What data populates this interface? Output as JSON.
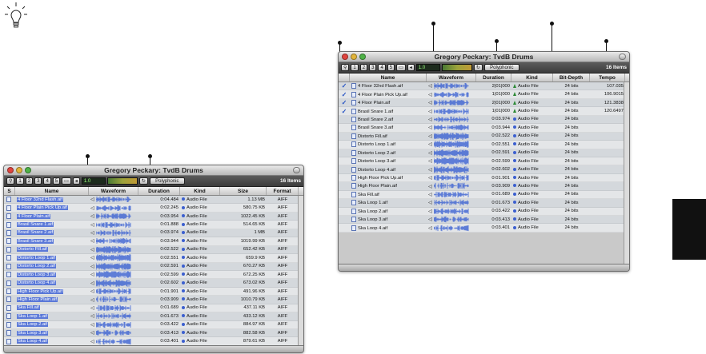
{
  "left_window": {
    "title": "Gregory Peckary: TvdB Drums",
    "toolbar": {
      "buttons": [
        "1",
        "2",
        "3",
        "4",
        "5"
      ],
      "meter": "1.0",
      "mode": "Polyphonic",
      "items": "16 Items"
    },
    "columns": [
      "S",
      "Name",
      "Waveform",
      "Duration",
      "Kind",
      "Size",
      "Format"
    ],
    "rows": [
      {
        "name": "4 Floor 32nd Flash.aif",
        "duration": "0:04.484",
        "kind": "Audio File",
        "size": "1.13 MB",
        "format": "AIFF"
      },
      {
        "name": "4 Floor Plain Pick Up.aif",
        "duration": "0:02.245",
        "kind": "Audio File",
        "size": "580.75 KB",
        "format": "AIFF"
      },
      {
        "name": "4 Floor Plain.aif",
        "duration": "0:03.954",
        "kind": "Audio File",
        "size": "1022.45 KB",
        "format": "AIFF"
      },
      {
        "name": "Brasil Snare 1.aif",
        "duration": "0:01.888",
        "kind": "Audio File",
        "size": "514.65 KB",
        "format": "AIFF"
      },
      {
        "name": "Brasil Snare 2.aif",
        "duration": "0:03.974",
        "kind": "Audio File",
        "size": "1 MB",
        "format": "AIFF"
      },
      {
        "name": "Brasil Snare 3.aif",
        "duration": "0:03.944",
        "kind": "Audio File",
        "size": "1019.99 KB",
        "format": "AIFF"
      },
      {
        "name": "Distorto Fill.aif",
        "duration": "0:02.522",
        "kind": "Audio File",
        "size": "652.42 KB",
        "format": "AIFF"
      },
      {
        "name": "Distorto Loop 1.aif",
        "duration": "0:02.551",
        "kind": "Audio File",
        "size": "659.9 KB",
        "format": "AIFF"
      },
      {
        "name": "Distorto Loop 2.aif",
        "duration": "0:02.591",
        "kind": "Audio File",
        "size": "670.27 KB",
        "format": "AIFF"
      },
      {
        "name": "Distorto Loop 3.aif",
        "duration": "0:02.599",
        "kind": "Audio File",
        "size": "672.25 KB",
        "format": "AIFF"
      },
      {
        "name": "Distorto Loop 4.aif",
        "duration": "0:02.602",
        "kind": "Audio File",
        "size": "673.02 KB",
        "format": "AIFF"
      },
      {
        "name": "High Floor Pick Up.aif",
        "duration": "0:01.901",
        "kind": "Audio File",
        "size": "491.96 KB",
        "format": "AIFF"
      },
      {
        "name": "High Floor Plain.aif",
        "duration": "0:03.909",
        "kind": "Audio File",
        "size": "1010.79 KB",
        "format": "AIFF"
      },
      {
        "name": "Ska Fill.aif",
        "duration": "0:01.689",
        "kind": "Audio File",
        "size": "437.11 KB",
        "format": "AIFF"
      },
      {
        "name": "Ska Loop 1.aif",
        "duration": "0:01.673",
        "kind": "Audio File",
        "size": "433.12 KB",
        "format": "AIFF"
      },
      {
        "name": "Ska Loop 2.aif",
        "duration": "0:03.422",
        "kind": "Audio File",
        "size": "884.97 KB",
        "format": "AIFF"
      },
      {
        "name": "Ska Loop 3.aif",
        "duration": "0:03.413",
        "kind": "Audio File",
        "size": "882.58 KB",
        "format": "AIFF"
      },
      {
        "name": "Ska Loop 4.aif",
        "duration": "0:03.401",
        "kind": "Audio File",
        "size": "879.61 KB",
        "format": "AIFF"
      }
    ]
  },
  "right_window": {
    "title": "Gregory Peckary: TvdB Drums",
    "toolbar": {
      "buttons": [
        "1",
        "2",
        "3",
        "4",
        "5"
      ],
      "meter": "1.0",
      "mode": "Polyphonic",
      "items": "16 Items"
    },
    "columns": [
      "",
      "Name",
      "Waveform",
      "Duration",
      "Kind",
      "Bit-Depth",
      "Tempo"
    ],
    "rows": [
      {
        "check": "✓",
        "name": "4 Floor 32nd Flash.aif",
        "duration": "2|01|000",
        "kind": "Audio File",
        "kind_icon": "triangle",
        "bits": "24 bits",
        "tempo": "107.035"
      },
      {
        "check": "✓",
        "name": "4 Floor Plain Pick Up.aif",
        "duration": "1|01|000",
        "kind": "Audio File",
        "kind_icon": "triangle",
        "bits": "24 bits",
        "tempo": "106.9015"
      },
      {
        "check": "✓",
        "name": "4 Floor Plain.aif",
        "duration": "2|01|000",
        "kind": "Audio File",
        "kind_icon": "triangle",
        "bits": "24 bits",
        "tempo": "121.3838"
      },
      {
        "check": "✓",
        "name": "Brasil Snare 1.aif",
        "duration": "1|01|000",
        "kind": "Audio File",
        "kind_icon": "triangle",
        "bits": "24 bits",
        "tempo": "120.6497"
      },
      {
        "check": "",
        "name": "Brasil Snare 2.aif",
        "duration": "0:03.974",
        "kind": "Audio File",
        "kind_icon": "dot",
        "bits": "24 bits",
        "tempo": ""
      },
      {
        "check": "",
        "name": "Brasil Snare 3.aif",
        "duration": "0:03.944",
        "kind": "Audio File",
        "kind_icon": "dot",
        "bits": "24 bits",
        "tempo": ""
      },
      {
        "check": "",
        "name": "Distorto Fill.aif",
        "duration": "0:02.522",
        "kind": "Audio File",
        "kind_icon": "dot",
        "bits": "24 bits",
        "tempo": ""
      },
      {
        "check": "",
        "name": "Distorto Loop 1.aif",
        "duration": "0:02.551",
        "kind": "Audio File",
        "kind_icon": "dot",
        "bits": "24 bits",
        "tempo": ""
      },
      {
        "check": "",
        "name": "Distorto Loop 2.aif",
        "duration": "0:02.591",
        "kind": "Audio File",
        "kind_icon": "dot",
        "bits": "24 bits",
        "tempo": ""
      },
      {
        "check": "",
        "name": "Distorto Loop 3.aif",
        "duration": "0:02.599",
        "kind": "Audio File",
        "kind_icon": "dot",
        "bits": "24 bits",
        "tempo": ""
      },
      {
        "check": "",
        "name": "Distorto Loop 4.aif",
        "duration": "0:02.602",
        "kind": "Audio File",
        "kind_icon": "dot",
        "bits": "24 bits",
        "tempo": ""
      },
      {
        "check": "",
        "name": "High Floor Pick Up.aif",
        "duration": "0:01.901",
        "kind": "Audio File",
        "kind_icon": "dot",
        "bits": "24 bits",
        "tempo": ""
      },
      {
        "check": "",
        "name": "High Floor Plain.aif",
        "duration": "0:03.909",
        "kind": "Audio File",
        "kind_icon": "dot",
        "bits": "24 bits",
        "tempo": ""
      },
      {
        "check": "",
        "name": "Ska Fill.aif",
        "duration": "0:01.689",
        "kind": "Audio File",
        "kind_icon": "dot",
        "bits": "24 bits",
        "tempo": ""
      },
      {
        "check": "",
        "name": "Ska Loop 1.aif",
        "duration": "0:01.673",
        "kind": "Audio File",
        "kind_icon": "dot",
        "bits": "24 bits",
        "tempo": ""
      },
      {
        "check": "",
        "name": "Ska Loop 2.aif",
        "duration": "0:03.422",
        "kind": "Audio File",
        "kind_icon": "dot",
        "bits": "24 bits",
        "tempo": ""
      },
      {
        "check": "",
        "name": "Ska Loop 3.aif",
        "duration": "0:03.413",
        "kind": "Audio File",
        "kind_icon": "dot",
        "bits": "24 bits",
        "tempo": ""
      },
      {
        "check": "",
        "name": "Ska Loop 4.aif",
        "duration": "0:03.401",
        "kind": "Audio File",
        "kind_icon": "dot",
        "bits": "24 bits",
        "tempo": ""
      }
    ]
  },
  "icons": {
    "tip": "lightbulb-icon",
    "search": "magnifier-icon",
    "folder": "folder-icon",
    "speaker": "speaker-icon",
    "audio_file": "audio-file-icon",
    "waveform": "waveform-icon",
    "checkmark": "checkmark-icon"
  },
  "colors": {
    "traffic_red": "#e0443e",
    "traffic_yellow": "#e2b43a",
    "traffic_green": "#4fb247",
    "selection": "#5a78d8",
    "waveform": "#3c63d2",
    "check": "#2653c4"
  }
}
